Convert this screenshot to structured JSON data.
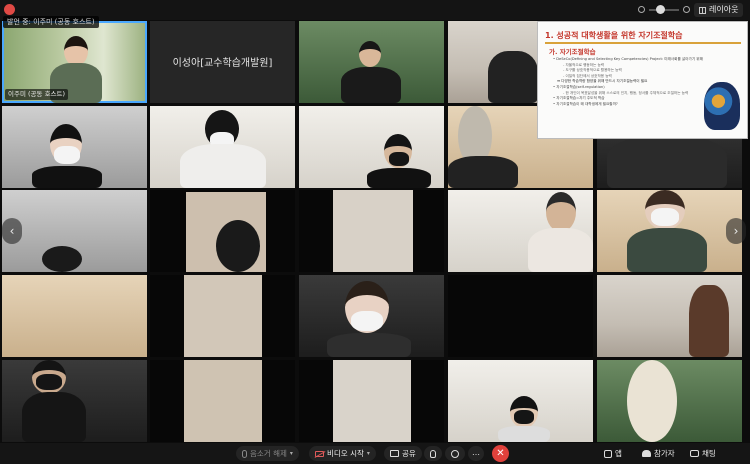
{
  "topbar": {
    "speaking_label": "발언 중: 이주미 (공동 호스트)",
    "layout_label": "레이아웃"
  },
  "tiles": {
    "host_name": "이주미 (공동 호스트)",
    "text_participant": "이성아[교수학습개발원]"
  },
  "slide": {
    "title": "1. 성공적 대학생활을 위한 자기조절학습",
    "subtitle": "가. 자기조절학습",
    "lines": [
      "• DeSeCo(Defining and Selecting Key Competencies) Project: 미래사회를 살아가기 위해 필요한 역량은 무엇인가?",
      "- 자율적으로 행동하는 능력",
      "- 도구를 상호작용적으로 활용하는 능력",
      "- 이질적 집단에서 상호작용 능력",
      "➡ 다양한 학습역량 함양을 위해 반드시 자기조절능력이 필요",
      "• 자기조절학습(self-regulation)",
      "- 한 개인이 목표달성을 위해 스스로의 인지, 행동, 정서를 주체적으로 조절하는 능력",
      "• 자기조절학습=자기 주도적 학습",
      "• 자기조절학습이 왜 대학생에게 필요할까?"
    ]
  },
  "toolbar": {
    "mute_label": "음소거 해제",
    "video_label": "비디오 시작",
    "share_label": "공유",
    "apps_label": "앱",
    "participants_label": "참가자",
    "chat_label": "채팅",
    "more_label": "…",
    "end_label": "✕"
  },
  "nav": {
    "prev": "‹",
    "next": "›"
  },
  "colors": {
    "accent": "#4aa8ff",
    "end": "#e0413c",
    "slide_title": "#c4362b"
  }
}
